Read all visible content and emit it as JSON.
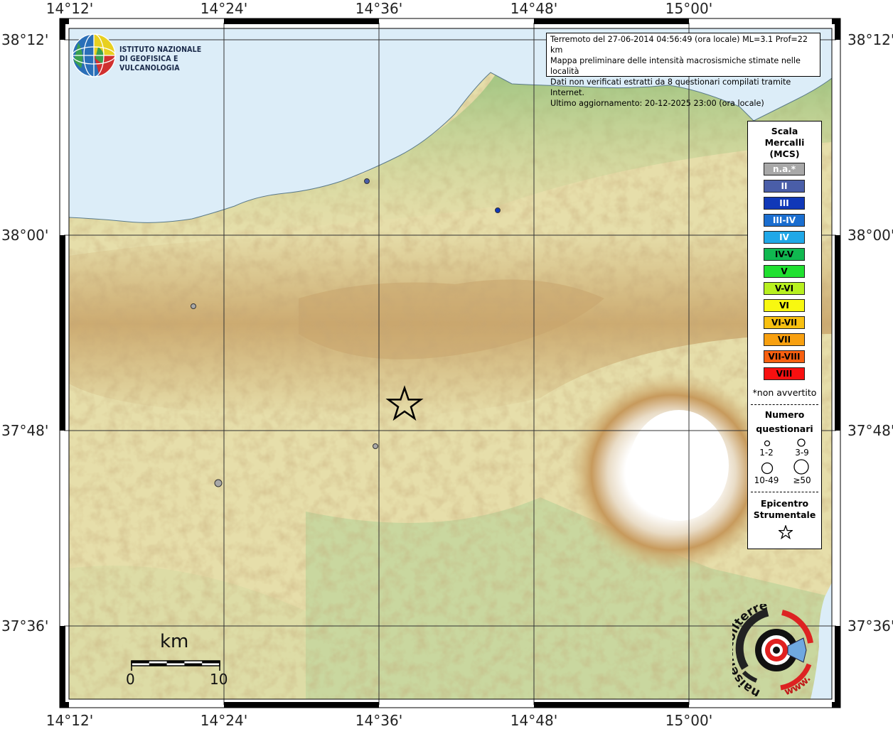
{
  "header": {
    "info_lines": [
      "Terremoto del 27-06-2014 04:56:49 (ora locale) ML=3.1 Prof=22 km",
      "Mappa preliminare delle intensità macrosismiche stimate nelle località",
      "Dati non verificati estratti da 8 questionari compilati tramite Internet.",
      "Ultimo aggiornamento: 20-12-2025 23:00 (ora locale)"
    ]
  },
  "logo": {
    "line1": "ISTITUTO NAZIONALE",
    "line2": "DI GEOFISICA E VULCANOLOGIA"
  },
  "axes": {
    "lon_labels": [
      "14°12'",
      "14°24'",
      "14°36'",
      "14°48'",
      "15°00'"
    ],
    "lat_labels": [
      "38°12'",
      "38°00'",
      "37°48'",
      "37°36'"
    ]
  },
  "legend": {
    "title_lines": [
      "Scala",
      "Mercalli",
      "(MCS)"
    ],
    "scale": [
      {
        "label": "n.a.*",
        "color": "#a8a8a8",
        "text_color": "#ffffff"
      },
      {
        "label": "II",
        "color": "#4a5ea8",
        "text_color": "#ffffff"
      },
      {
        "label": "III",
        "color": "#1038b8",
        "text_color": "#ffffff"
      },
      {
        "label": "III-IV",
        "color": "#1a6ed0",
        "text_color": "#ffffff"
      },
      {
        "label": "IV",
        "color": "#20a8e8",
        "text_color": "#ffffff"
      },
      {
        "label": "IV-V",
        "color": "#10b850",
        "text_color": "#000000"
      },
      {
        "label": "V",
        "color": "#20e030",
        "text_color": "#000000"
      },
      {
        "label": "V-VI",
        "color": "#b8f020",
        "text_color": "#000000"
      },
      {
        "label": "VI",
        "color": "#f8f810",
        "text_color": "#000000"
      },
      {
        "label": "VI-VII",
        "color": "#f8c010",
        "text_color": "#000000"
      },
      {
        "label": "VII",
        "color": "#f8a010",
        "text_color": "#000000"
      },
      {
        "label": "VII-VIII",
        "color": "#f86010",
        "text_color": "#000000"
      },
      {
        "label": "VIII",
        "color": "#f81010",
        "text_color": "#000000"
      }
    ],
    "not_felt_note": "*non avvertito",
    "count_title_lines": [
      "Numero",
      "questionari"
    ],
    "counts": [
      "1-2",
      "3-9",
      "10-49",
      "≥50"
    ],
    "epicenter_lines": [
      "Epicentro",
      "Strumentale"
    ]
  },
  "scale_bar": {
    "unit": "km",
    "min": "0",
    "max": "10"
  },
  "badge": {
    "ring_text": "haisentitoilterremoto.it",
    "url_text": "www."
  },
  "observations": [
    {
      "intensity": "II",
      "count": "1-2"
    },
    {
      "intensity": "III",
      "count": "1-2"
    },
    {
      "intensity": "n.a.*",
      "count": "1-2"
    },
    {
      "intensity": "n.a.*",
      "count": "1-2"
    },
    {
      "intensity": "n.a.*",
      "count": "3-9"
    }
  ]
}
